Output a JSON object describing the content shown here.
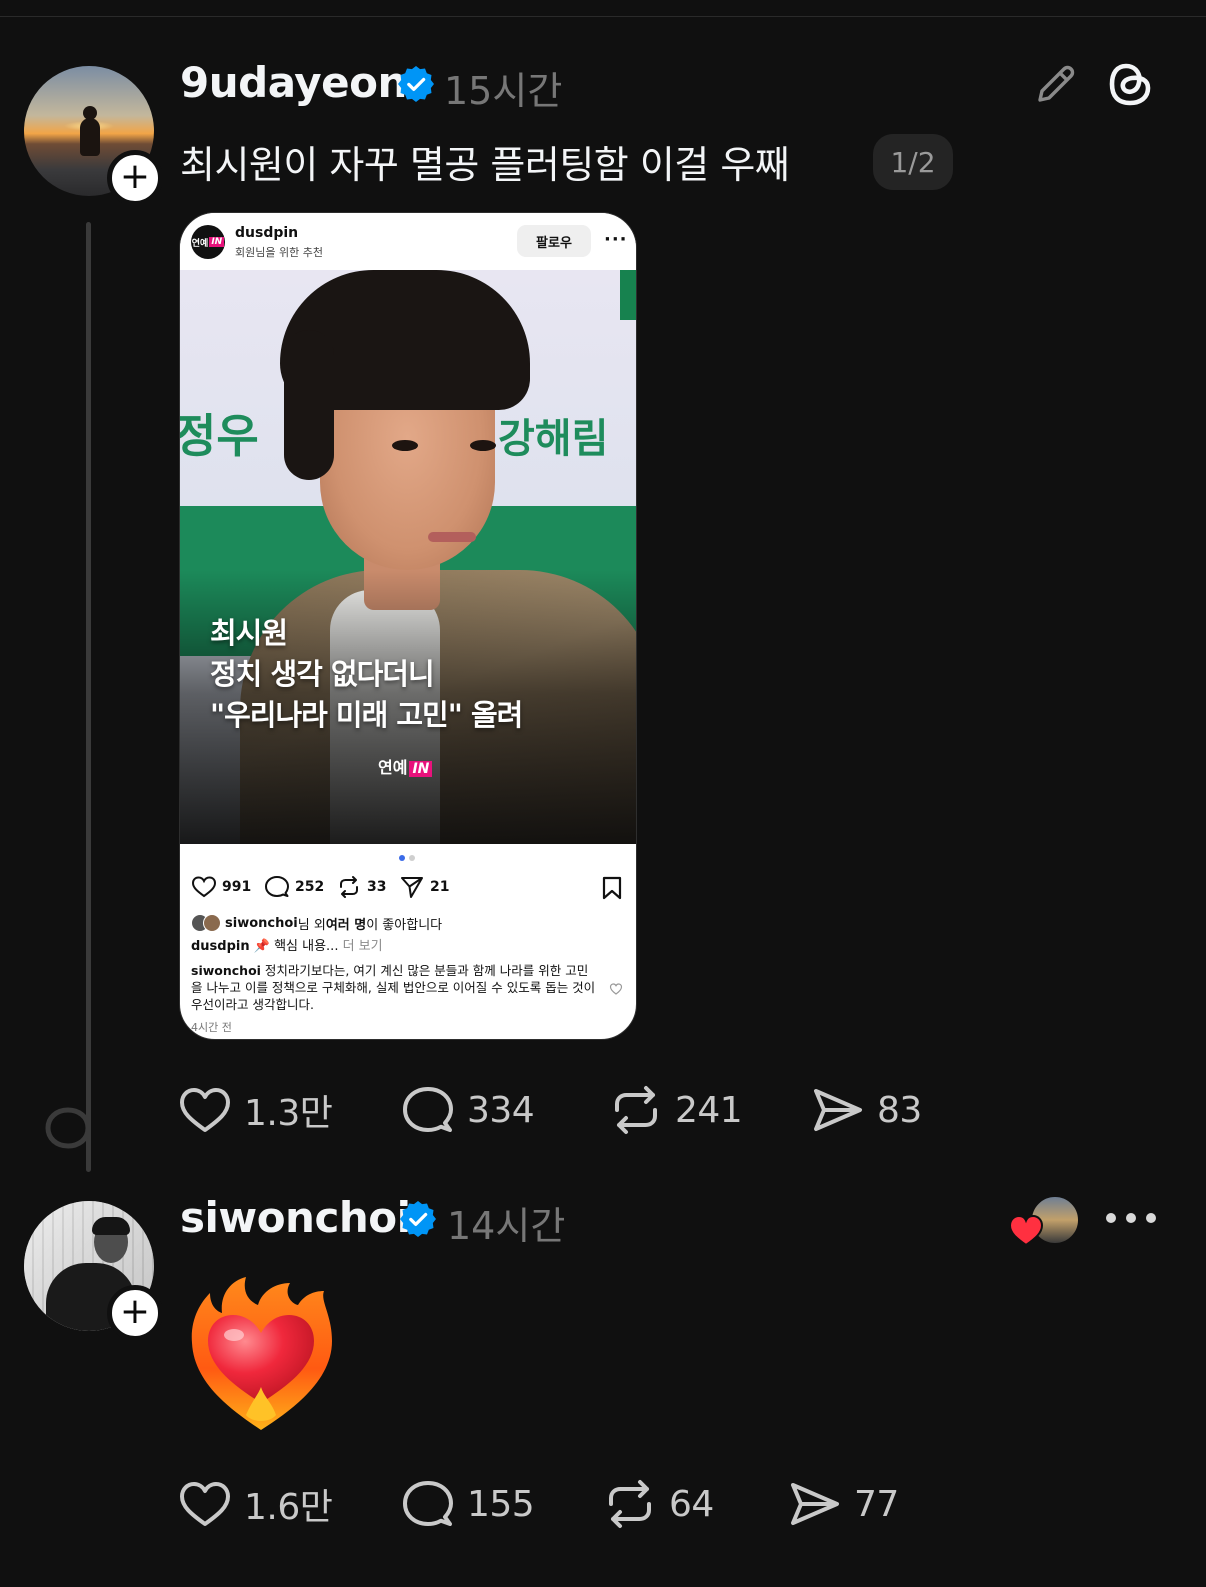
{
  "post1": {
    "username": "9udayeon",
    "time": "15시간",
    "text": "최시원이 자꾸 멸공 플러팅함 이걸 우째",
    "page_indicator": "1/2",
    "actions": {
      "likes": "1.3만",
      "comments": "334",
      "reposts": "241",
      "shares": "83"
    },
    "embed": {
      "username": "dusdpin",
      "subtitle": "회원님을 위한 추천",
      "follow_label": "팔로우",
      "avatar_text": "연예",
      "avatar_badge": "IN",
      "sign_left": "정우",
      "sign_right": "강해림",
      "headline": [
        "최시원",
        "정치 생각 없다더니",
        "\"우리나라 미래 고민\" 올려"
      ],
      "logo_text": "연예",
      "logo_badge": "IN",
      "likes": "991",
      "comments": "252",
      "reposts": "33",
      "shares": "21",
      "liked_by_user": "siwonchoi",
      "liked_by_mid": "님 외 ",
      "liked_by_bold": "여러 명",
      "liked_by_end": "이 좋아합니다",
      "caption_user": "dusdpin",
      "caption_text": " 📌 핵심 내용...",
      "caption_more": " 더 보기",
      "comment_user": "siwonchoi",
      "comment_text": " 정치라기보다는, 여기 계신 많은 분들과 함께 나라를 위한 고민을 나누고 이를 정책으로 구체화해, 실제 법안으로 이어질 수 있도록 돕는 것이 우선이라고 생각합니다.",
      "comment_time": "4시간 전"
    }
  },
  "post2": {
    "username": "siwonchoi",
    "time": "14시간",
    "emoji_icon": "heart-on-fire",
    "actions": {
      "likes": "1.6만",
      "comments": "155",
      "reposts": "64",
      "shares": "77"
    }
  },
  "colors": {
    "background": "#101010",
    "verified": "#0095f6",
    "liked_red": "#ff3040",
    "badge_pink": "#e8127c"
  }
}
